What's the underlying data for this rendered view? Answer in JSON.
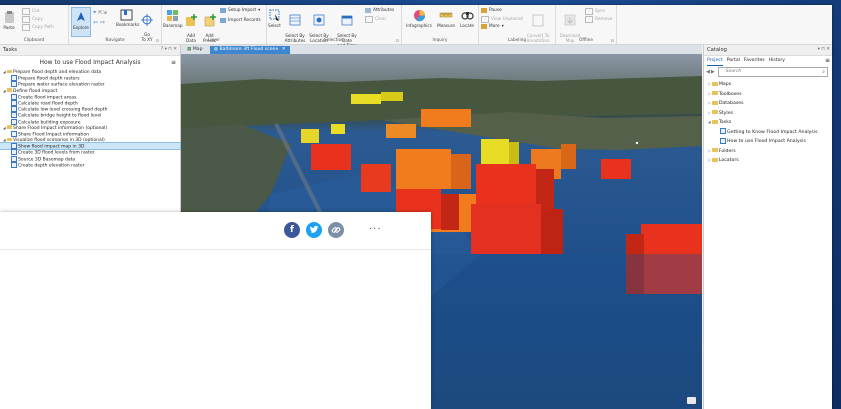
{
  "ribbon": {
    "clipboard": {
      "paste": "Paste",
      "cut": "Cut",
      "copy": "Copy",
      "copy_path": "Copy Path",
      "label": "Clipboard"
    },
    "navigate": {
      "explore": "Explore",
      "bookmarks": "Bookmarks",
      "go_to_xy": "Go\nTo XY",
      "label": "Navigate"
    },
    "layer": {
      "basemap": "Basemap",
      "add_data": "Add\nData",
      "add_preset": "Add\nPreset",
      "setup_import": "Setup Import",
      "import_records": "Import Records",
      "label": "Layer"
    },
    "selection": {
      "select": "Select",
      "select_by_attributes": "Select By\nAttributes",
      "select_by_location": "Select By\nLocation",
      "select_by_date": "Select By Date\nand Time",
      "attributes": "Attributes",
      "clear": "Clear",
      "label": "Selection"
    },
    "inquiry": {
      "infographics": "Infographics",
      "measure": "Measure",
      "locate": "Locate",
      "label": "Inquiry"
    },
    "labeling": {
      "pause": "Pause",
      "view_unplaced": "View Unplaced",
      "more": "More",
      "convert_to_annotation": "Convert To\nAnnotation",
      "label": "Labeling"
    },
    "offline": {
      "download_map": "Download\nMap",
      "sync": "Sync",
      "remove": "Remove",
      "label": "Offline"
    }
  },
  "tasks": {
    "pane_title": "Tasks",
    "controls": "? ▾ ⊓ ✕",
    "title": "How to use Flood Impact Analysis",
    "items": [
      {
        "level": 0,
        "type": "group",
        "label": "Prepare flood depth and elevation data"
      },
      {
        "level": 1,
        "type": "task",
        "label": "Prepare flood depth rasters"
      },
      {
        "level": 1,
        "type": "task",
        "label": "Prepare water surface elevation raster"
      },
      {
        "level": 0,
        "type": "group",
        "label": "Define flood impact"
      },
      {
        "level": 1,
        "type": "task",
        "label": "Create flood impact areas"
      },
      {
        "level": 1,
        "type": "task",
        "label": "Calculate road flood depth"
      },
      {
        "level": 1,
        "type": "task",
        "label": "Calculate low level crossing flood depth"
      },
      {
        "level": 1,
        "type": "task",
        "label": "Calculate bridge height to flood level"
      },
      {
        "level": 1,
        "type": "task",
        "label": "Calculate building exposure"
      },
      {
        "level": 0,
        "type": "group",
        "label": "Share Flood Impact information (optional)"
      },
      {
        "level": 1,
        "type": "task",
        "label": "Share Flood Impact information"
      },
      {
        "level": 0,
        "type": "group",
        "label": "Visualize flood scenarios in 3D (optional)"
      },
      {
        "level": 1,
        "type": "task",
        "label": "Show flood impact map in 3D",
        "selected": true
      },
      {
        "level": 1,
        "type": "task",
        "label": "Create 3D flood levels from raster"
      },
      {
        "level": 1,
        "type": "task",
        "label": "Source 3D Basemap data"
      },
      {
        "level": 1,
        "type": "task",
        "label": "Create depth elevation raster"
      }
    ]
  },
  "map_tabs": [
    {
      "label": "Map",
      "active": false
    },
    {
      "label": "Baltimore 3ft Flood scene",
      "active": true
    }
  ],
  "catalog": {
    "pane_title": "Catalog",
    "controls": "▾ ⊓ ✕",
    "tabs": [
      "Project",
      "Portal",
      "Favorites",
      "History"
    ],
    "search_placeholder": "Search",
    "items": [
      {
        "level": 0,
        "expanded": false,
        "label": "Maps"
      },
      {
        "level": 0,
        "expanded": false,
        "label": "Toolboxes"
      },
      {
        "level": 0,
        "expanded": false,
        "label": "Databases"
      },
      {
        "level": 0,
        "expanded": false,
        "label": "Styles"
      },
      {
        "level": 0,
        "expanded": true,
        "label": "Tasks"
      },
      {
        "level": 1,
        "label": "Getting to Know Flood Impact Analysis"
      },
      {
        "level": 1,
        "label": "How to use Flood Impact Analysis"
      },
      {
        "level": 0,
        "expanded": false,
        "label": "Folders"
      },
      {
        "level": 0,
        "expanded": false,
        "label": "Locators"
      }
    ]
  },
  "share": {
    "more": "···"
  },
  "colors": {
    "ribbon_bg": "#f7f7f7",
    "accent": "#3f86d1",
    "selected_row": "#cde6f7",
    "facebook": "#3b5998",
    "twitter": "#1da1f2",
    "link": "#7b8fa8",
    "flood_red": "#e8321e",
    "flood_orange": "#f07c1e",
    "flood_yellow": "#e8dc24",
    "water": "#1f4f8a"
  }
}
